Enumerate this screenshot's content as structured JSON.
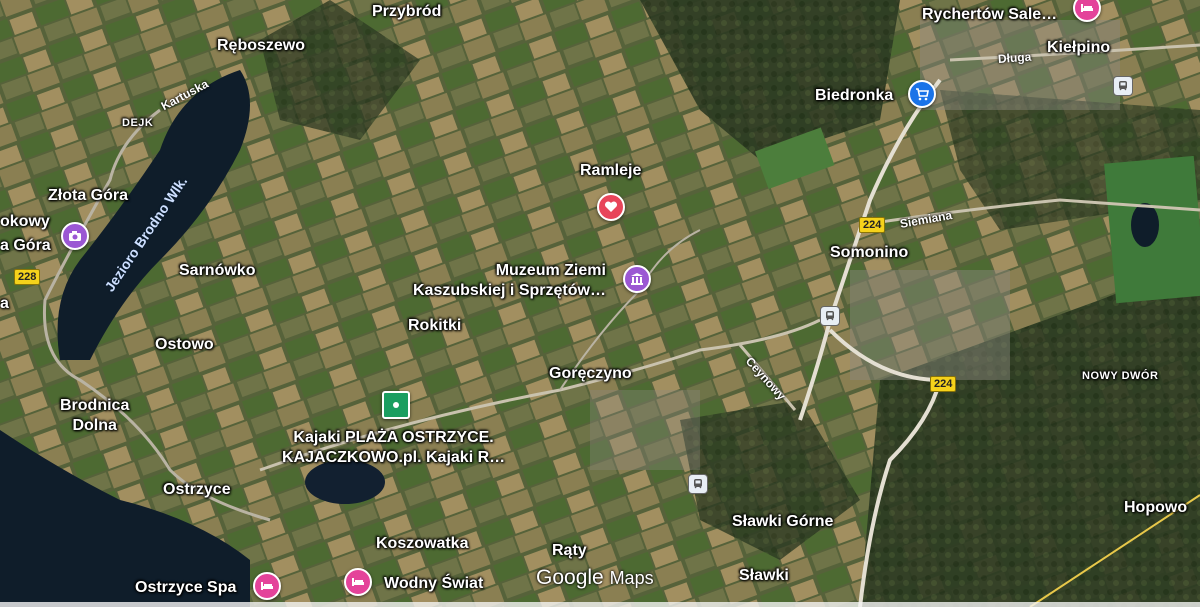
{
  "colors": {
    "poi_pink": "#e4439a",
    "poi_purple": "#9b57d3",
    "poi_green": "#1b9e60",
    "shop_blue": "#1a73e8",
    "heart_red": "#e8455a",
    "shield_yellow": "#f5d21b"
  },
  "places": {
    "przybrod": "Przybród",
    "reboszewo": "Rębosz­ewo",
    "dejk": "DEJK",
    "zlota_gora": "Złota Góra",
    "sarnowko": "Sarnówko",
    "ostowo": "Ostowo",
    "brodnica_dolna": "Brodnica\nDolna",
    "ostrzyce": "Ostrzyce",
    "koszowatka": "Koszowatka",
    "raty": "Rąty",
    "rokitki": "Rokitki",
    "gorczyno": "Goręczyno",
    "ramleje": "Ramleje",
    "somonino": "Somonino",
    "kielpino": "Kiełpino",
    "nowy_dwor": "NOWY DWÓR",
    "hopowo": "Hopowo",
    "slawki_gorne": "Sławki Górne",
    "slawki": "Sławki"
  },
  "pois": {
    "rychertow": "Rychertów Sale…",
    "biedronka": "Biedronka",
    "muzeum": "Muzeum Ziemi\nKaszubskiej i Sprzętów…",
    "kajaki": "Kajaki PLAŻA OSTRZYCE.\nKAJACZKOWO.pl. Kajaki R…",
    "ostrzyce_spa": "Ostrzyce Spa",
    "wodny_swiat": "Wodny Świat",
    "left_edge_top": "okowy",
    "left_edge_bottom": "a Góra",
    "left_edge_a": "a"
  },
  "roads": {
    "kartuska": "Kartuska",
    "dluga": "Długa",
    "siemiana": "Siemiana",
    "ceynowy": "Ceynowy"
  },
  "water": {
    "jezioro": "Jezioro Brodno Wlk."
  },
  "shields": {
    "r228": "228",
    "r224_top": "224",
    "r224_mid": "224"
  },
  "icons": {
    "camera": "camera-icon",
    "heart": "heart-icon",
    "museum": "museum-icon",
    "cart": "shopping-cart-icon",
    "hotel": "bed-icon",
    "rail": "train-icon",
    "park": "park-icon"
  },
  "branding": {
    "google": "Google",
    "maps": "Maps"
  }
}
